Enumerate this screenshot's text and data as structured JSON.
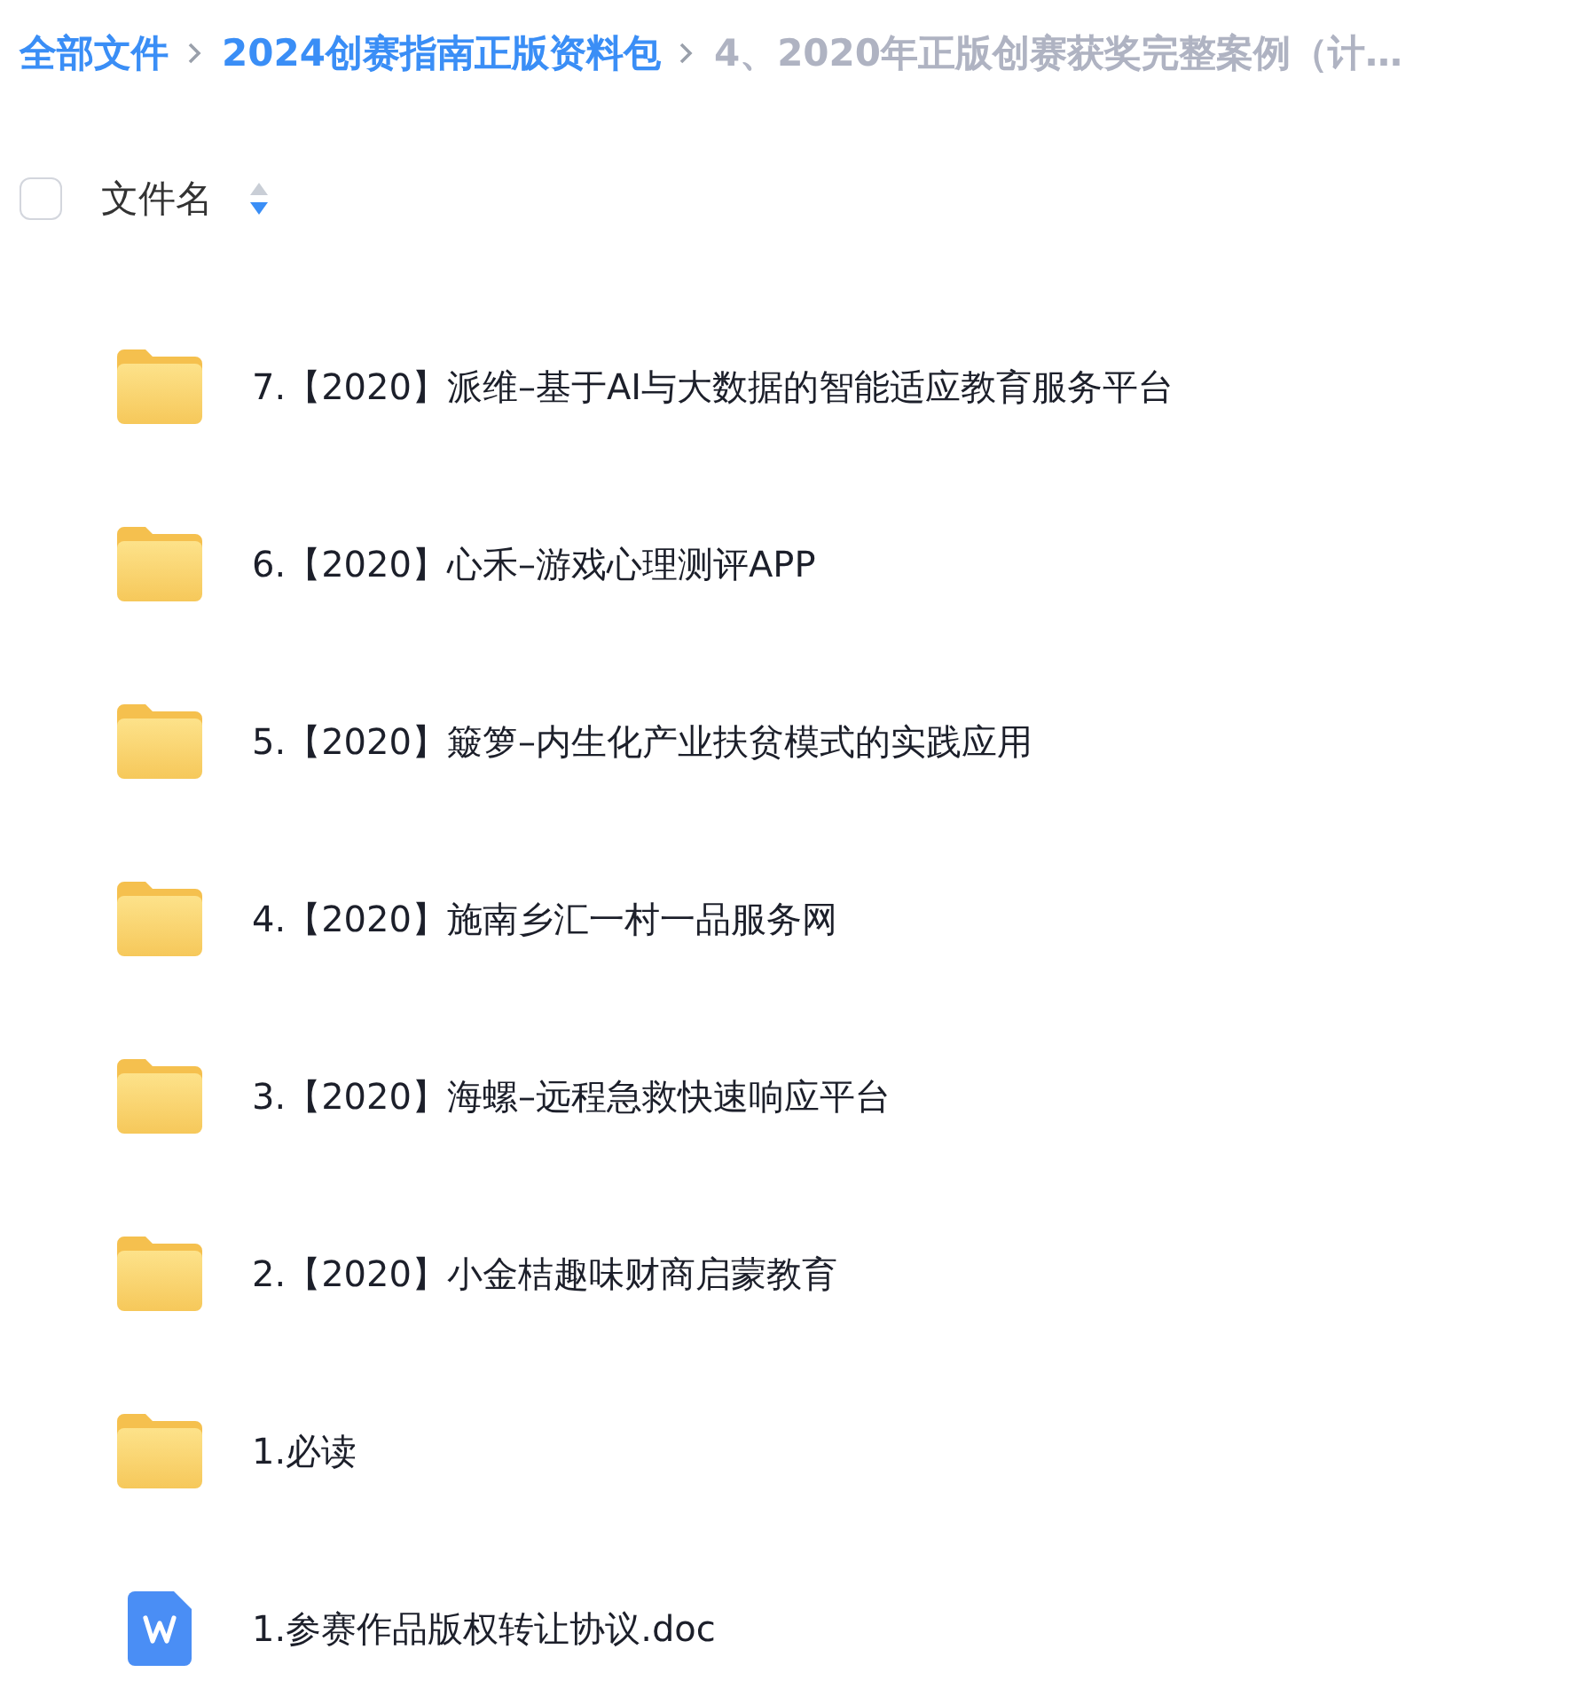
{
  "breadcrumb": [
    {
      "label": "全部文件",
      "current": false
    },
    {
      "label": "2024创赛指南正版资料包",
      "current": false
    },
    {
      "label": "4、2020年正版创赛获奖完整案例（计…",
      "current": true
    }
  ],
  "header": {
    "select_all": {
      "checked": false
    },
    "column": "文件名",
    "sort_descending": true
  },
  "files": [
    {
      "kind": "folder",
      "name": "7.【2020】派维–基于AI与大数据的智能适应教育服务平台"
    },
    {
      "kind": "folder",
      "name": "6.【2020】心禾–游戏心理测评APP"
    },
    {
      "kind": "folder",
      "name": "5.【2020】簸箩–内生化产业扶贫模式的实践应用"
    },
    {
      "kind": "folder",
      "name": "4.【2020】施南乡汇一村一品服务网"
    },
    {
      "kind": "folder",
      "name": "3.【2020】海螺–远程急救快速响应平台"
    },
    {
      "kind": "folder",
      "name": "2.【2020】小金桔趣味财商启蒙教育"
    },
    {
      "kind": "folder",
      "name": "1.必读"
    },
    {
      "kind": "doc",
      "name": "1.参赛作品版权转让协议.doc"
    }
  ]
}
